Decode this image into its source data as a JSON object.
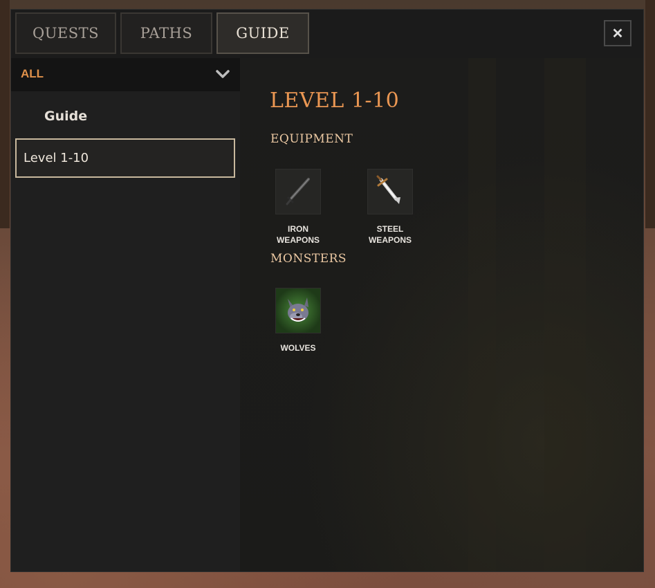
{
  "tabs": [
    {
      "label": "QUESTS",
      "active": false
    },
    {
      "label": "PATHS",
      "active": false
    },
    {
      "label": "GUIDE",
      "active": true
    }
  ],
  "close_button": {
    "icon": "close-icon",
    "label": "✕"
  },
  "sidebar": {
    "filter": {
      "label": "ALL",
      "icon": "chevron-down-icon"
    },
    "items": [
      {
        "label": "Guide",
        "selected": false
      },
      {
        "label": "Level 1-10",
        "selected": true
      }
    ]
  },
  "content": {
    "title": "LEVEL 1-10",
    "sections": [
      {
        "heading": "EQUIPMENT",
        "items": [
          {
            "label": "IRON\nWEAPONS",
            "icon": "iron-sword-icon"
          },
          {
            "label": "STEEL\nWEAPONS",
            "icon": "steel-sword-icon"
          }
        ]
      },
      {
        "heading": "MONSTERS",
        "items": [
          {
            "label": "WOLVES",
            "icon": "wolf-icon"
          }
        ]
      }
    ]
  },
  "colors": {
    "accent": "#e0914a",
    "title": "#eb9753",
    "heading": "#ecc9a3",
    "selected_border": "#c9b99e"
  }
}
